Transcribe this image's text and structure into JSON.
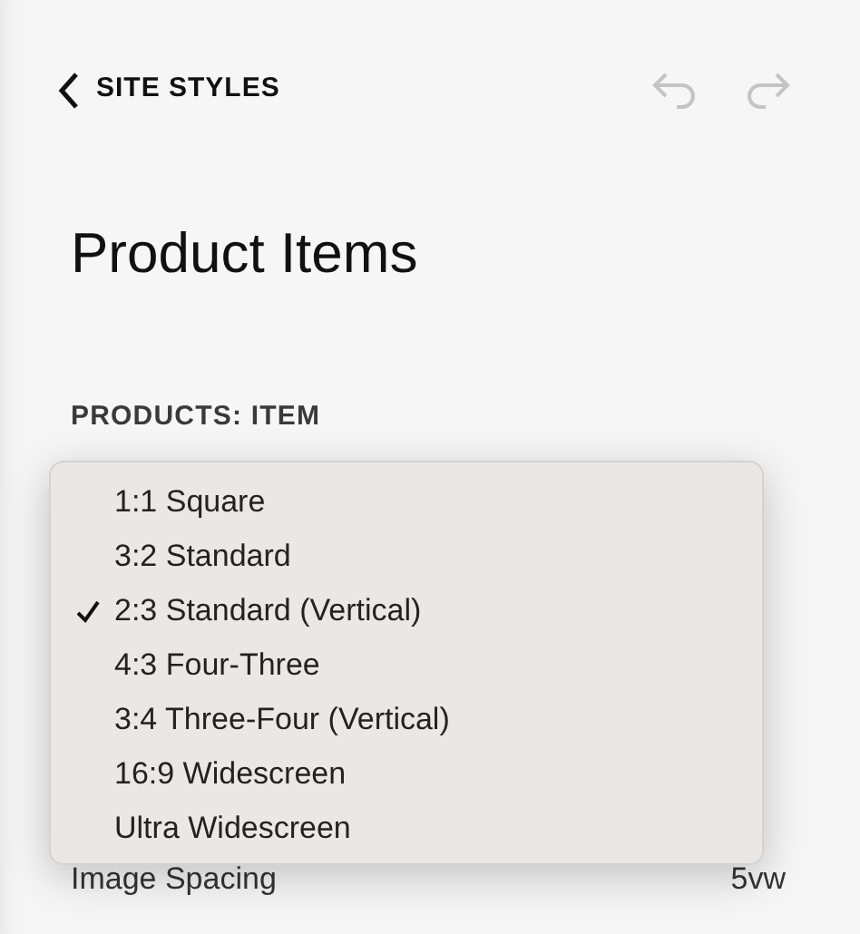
{
  "header": {
    "back_label": "SITE STYLES"
  },
  "title": "Product Items",
  "section_label": "PRODUCTS: ITEM",
  "dropdown_menu": {
    "options": [
      {
        "label": "1:1 Square",
        "selected": false
      },
      {
        "label": "3:2 Standard",
        "selected": false
      },
      {
        "label": "2:3 Standard (Vertical)",
        "selected": true
      },
      {
        "label": "4:3 Four-Three",
        "selected": false
      },
      {
        "label": "3:4 Three-Four (Vertical)",
        "selected": false
      },
      {
        "label": "16:9 Widescreen",
        "selected": false
      },
      {
        "label": "Ultra Widescreen",
        "selected": false
      }
    ]
  },
  "setting_row": {
    "label": "Image Spacing",
    "value": "5vw"
  }
}
